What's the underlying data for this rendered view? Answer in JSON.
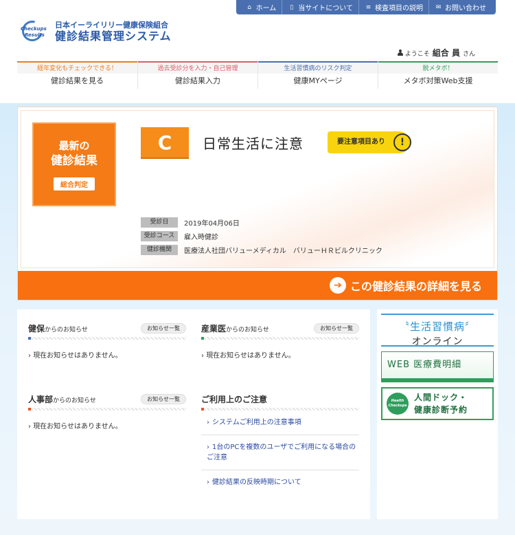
{
  "top_nav": [
    {
      "icon": "home-icon",
      "glyph": "⌂",
      "label": "ホーム"
    },
    {
      "icon": "book-icon",
      "glyph": "▯",
      "label": "当サイトについて"
    },
    {
      "icon": "list-icon",
      "glyph": "≡",
      "label": "検査項目の説明"
    },
    {
      "icon": "mail-icon",
      "glyph": "✉",
      "label": "お問い合わせ"
    }
  ],
  "logo": {
    "mark_line1": "Checkups",
    "mark_line2": "Results",
    "org": "日本イーライリリー健康保険組合",
    "system": "健診結果管理システム"
  },
  "welcome": {
    "prefix": "ようこそ",
    "name": "組合 員",
    "suffix": "さん"
  },
  "main_nav": [
    {
      "tag": "経年変化もチェックできる！",
      "label": "健診結果を見る",
      "color": "#f47b16"
    },
    {
      "tag": "過去受診分を入力・自己管理",
      "label": "健診結果入力",
      "color": "#e05a6a"
    },
    {
      "tag": "生活習慣病のリスク判定",
      "label": "健康MYページ",
      "color": "#4a6fb0"
    },
    {
      "tag": "脱メタボ！",
      "label": "メタボ対策Web支援",
      "color": "#2f9e5c"
    }
  ],
  "result": {
    "latest_line1": "最新の",
    "latest_line2": "健診結果",
    "overall_label": "総合判定",
    "grade": "C",
    "grade_text": "日常生活に注意",
    "warning": "要注意項目あり",
    "warning_mark": "!",
    "info": [
      {
        "key": "受診日",
        "value": "2019年04月06日"
      },
      {
        "key": "受診コース",
        "value": "雇入時健診"
      },
      {
        "key": "健診機関",
        "value": "医療法人社団バリューメディカル　バリューＨＲビルクリニック"
      }
    ],
    "detail_link": "この健診結果の詳細を見る"
  },
  "notices": {
    "more_label": "お知らせ一覧",
    "empty": "現在お知らせはありません。",
    "suffix": "からのお知らせ",
    "kenpo": {
      "title": "健保"
    },
    "sangyoui": {
      "title": "産業医"
    },
    "jinjibu": {
      "title": "人事部"
    }
  },
  "usage": {
    "title": "ご利用上のご注意",
    "links": [
      "システムご利用上の注意事項",
      "1台のPCを複数のユーザでご利用になる場合のご注意",
      "健診結果の反映時期について"
    ]
  },
  "banners": {
    "b1_line1": "〝生活習慣病〞",
    "b1_line2": "オンライン",
    "b2": "WEB 医療費明細",
    "b3_mark": "Health Checkups",
    "b3_line1": "人間ドック・",
    "b3_line2": "健康診断予約"
  },
  "colors": {
    "accent": "#f47b16",
    "brand": "#2a5aa8",
    "nav": "#4a6fb0",
    "green": "#2f9e5c"
  }
}
